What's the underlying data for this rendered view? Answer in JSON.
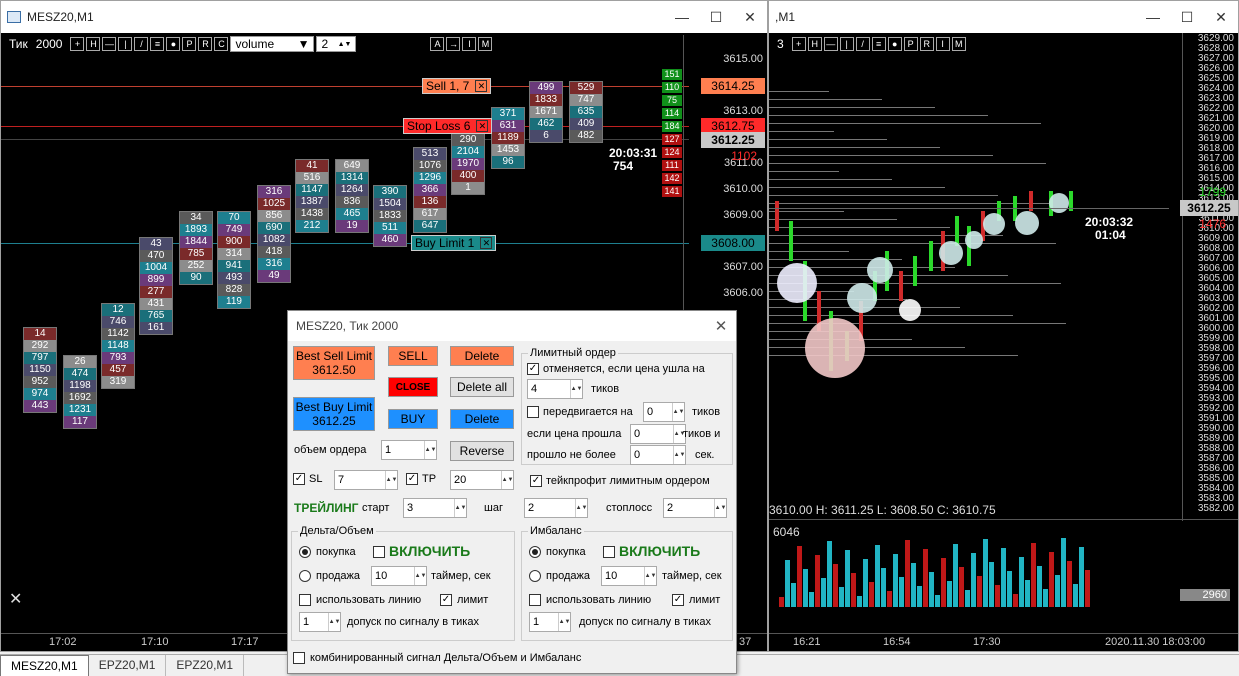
{
  "left_window": {
    "title": "MESZ20,M1",
    "toolbar": {
      "label": "Тик",
      "ticks": "2000",
      "buttons": [
        "+",
        "H",
        "—",
        "|",
        "/",
        "≡",
        "●",
        "P",
        "R",
        "C"
      ],
      "select": "volume",
      "count": "2",
      "right_buttons": [
        "A",
        "→",
        "I",
        "M"
      ]
    },
    "price_ticks": [
      "3615.00",
      "3614.00",
      "3613.00",
      "3612.00",
      "3611.00",
      "3610.00",
      "3609.00",
      "3608.00",
      "3607.00",
      "3606.00"
    ],
    "price_labels": {
      "sell": "3614.25",
      "stop": "3612.75",
      "current": "3612.25",
      "delta": "1102",
      "buy": "3608.00"
    },
    "timer": "20:03:31",
    "timer_count": "754",
    "side_counts": [
      "151",
      "110",
      "75",
      "114",
      "184",
      "127",
      "124",
      "111",
      "142",
      "141"
    ],
    "orders": {
      "sell": "Sell 1, 7",
      "stop": "Stop Loss 6",
      "buy": "Buy Limit 1"
    },
    "clusters": [
      [
        "14",
        "292",
        "797",
        "1150",
        "952",
        "974",
        "443"
      ],
      [
        "26",
        "474",
        "1198",
        "1692",
        "1231",
        "117"
      ],
      [
        "12",
        "746",
        "1142",
        "1148",
        "793",
        "457",
        "319"
      ],
      [
        "43",
        "470",
        "1004",
        "899",
        "277",
        "431",
        "765",
        "161"
      ],
      [
        "34",
        "1893",
        "1844",
        "785",
        "252",
        "90"
      ],
      [
        "70",
        "749",
        "900",
        "314",
        "941",
        "493",
        "828",
        "119"
      ],
      [
        "316",
        "1025",
        "856",
        "690",
        "1082",
        "418",
        "316",
        "49"
      ],
      [
        "41",
        "516",
        "1147",
        "1387",
        "1438",
        "212"
      ],
      [
        "649",
        "1314",
        "1264",
        "836",
        "465",
        "19"
      ],
      [
        "390",
        "1504",
        "1833",
        "511",
        "460"
      ],
      [
        "513",
        "1076",
        "1296",
        "366",
        "136",
        "617",
        "647"
      ],
      [
        "290",
        "2104",
        "1970",
        "400",
        "1"
      ],
      [
        "371",
        "631",
        "1189",
        "1453",
        "96"
      ],
      [
        "499",
        "1833",
        "1671",
        "462",
        "6"
      ],
      [
        "529",
        "747",
        "635",
        "409",
        "482"
      ]
    ],
    "time_axis": [
      "17:02",
      "17:10",
      "17:17"
    ]
  },
  "right_window": {
    "title": ",M1",
    "toolbar_count": "3",
    "buttons": [
      "+",
      "H",
      "—",
      "|",
      "/",
      "≡",
      "●",
      "P",
      "R",
      "I",
      "M"
    ],
    "price_ticks": [
      "3629.00",
      "3628.00",
      "3627.00",
      "3626.00",
      "3625.00",
      "3624.00",
      "3623.00",
      "3622.00",
      "3621.00",
      "3620.00",
      "3619.00",
      "3618.00",
      "3617.00",
      "3616.00",
      "3615.00",
      "3614.00",
      "3613.00",
      "3612.00",
      "3611.00",
      "3610.00",
      "3609.00",
      "3608.00",
      "3607.00",
      "3606.00",
      "3605.00",
      "3604.00",
      "3603.00",
      "3602.00",
      "3601.00",
      "3600.00",
      "3599.00",
      "3598.00",
      "3597.00",
      "3596.00",
      "3595.00",
      "3594.00",
      "3593.00",
      "3592.00",
      "3591.00",
      "3590.00",
      "3589.00",
      "3588.00",
      "3587.00",
      "3586.00",
      "3585.00",
      "3584.00",
      "3583.00",
      "3582.00"
    ],
    "green_count": "1799",
    "current": "3612.25",
    "red_count": "1476",
    "timer": "20:03:32",
    "timer2": "01:04",
    "ohlc": "3610.00  H: 3611.25  L: 3608.50  C: 3610.75",
    "volume_max": "6046",
    "volume_label": "2960",
    "time_axis": [
      "16:21",
      "16:54",
      "17:30"
    ],
    "datetime": "2020.11.30 18:03:00",
    "edge_label": "37"
  },
  "dialog": {
    "title": "MESZ20, Тик 2000",
    "best_sell": "Best Sell Limit",
    "best_sell_price": "3612.50",
    "best_buy": "Best Buy Limit",
    "best_buy_price": "3612.25",
    "sell": "SELL",
    "close": "CLOSE",
    "buy": "BUY",
    "delete": "Delete",
    "delete_all": "Delete all",
    "reverse": "Reverse",
    "order_volume_label": "объем ордера",
    "order_volume": "1",
    "sl_label": "SL",
    "sl_value": "7",
    "tp_label": "TP",
    "tp_value": "20",
    "trailing": "ТРЕЙЛИНГ",
    "start_label": "старт",
    "start_value": "3",
    "step_label": "шаг",
    "step_value": "2",
    "stoploss_label": "стоплосс",
    "stoploss_value": "2",
    "limit_group": "Лимитный ордер",
    "cancel_label": "отменяется, если цена ушла на",
    "cancel_value": "4",
    "ticks1": "тиков",
    "moves_label": "передвигается на",
    "moves_value": "0",
    "ticks2": "тиков",
    "if_passed_label": "если цена прошла",
    "if_passed_value": "0",
    "ticks_and": "тиков и",
    "no_more_label": "прошло не более",
    "no_more_value": "0",
    "sec": "сек.",
    "tp_limit_label": "тейкпрофит лимитным ордером",
    "delta_group": "Дельта/Объем",
    "imb_group": "Имбаланс",
    "buy_label": "покупка",
    "sell_label": "продажа",
    "enable": "ВКЛЮЧИТЬ",
    "timer_value": "10",
    "timer_label": "таймер, сек",
    "use_line": "использовать линию",
    "limit_label": "лимит",
    "tolerance_value": "1",
    "tolerance_label": "допуск по сигналу в тиках",
    "combined": "комбинированный сигнал Дельта/Объем и Имбаланс"
  },
  "tabs": [
    "MESZ20,M1",
    "EPZ20,M1",
    "EPZ20,M1"
  ],
  "colors": {
    "sell": "#ff7f50",
    "stop": "#ff2a2a",
    "buy": "#1e90ff",
    "close": "#ff0000",
    "green": "#1a7a1a",
    "cyan": "#21b5c4"
  }
}
